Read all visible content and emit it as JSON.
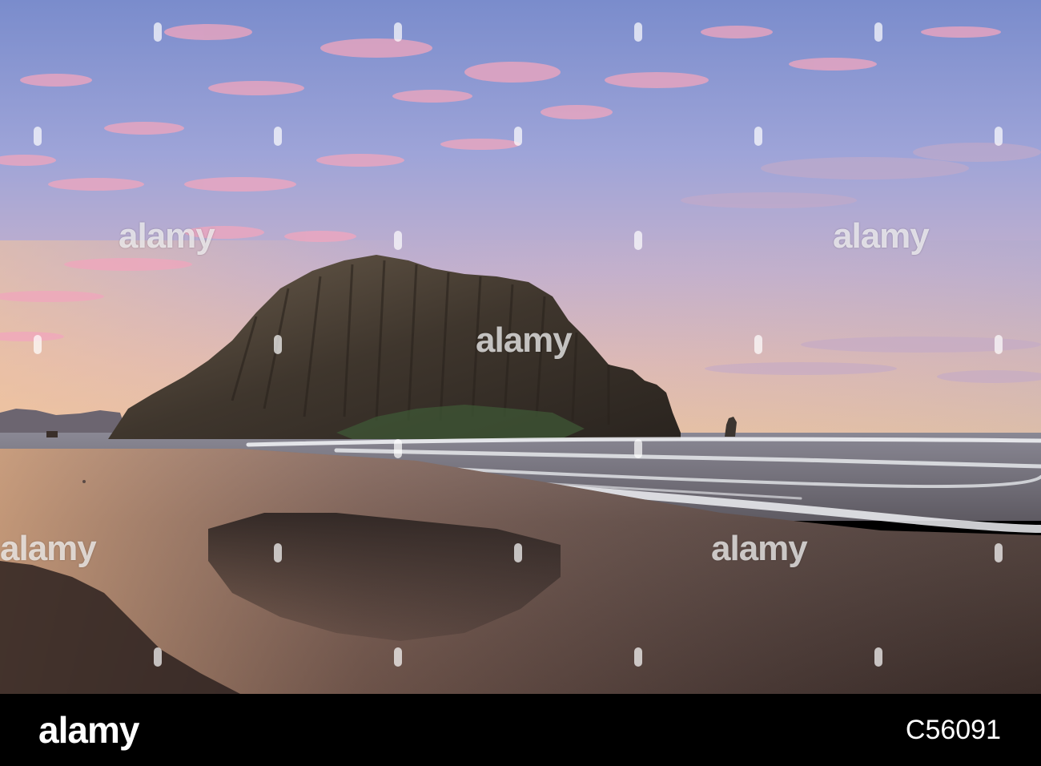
{
  "watermark": {
    "text": "alamy",
    "color": "#ffffff"
  },
  "footer": {
    "logo_text": "alamy",
    "image_id": "C56091",
    "background": "#000000",
    "text_color": "#ffffff"
  },
  "scene": {
    "subject": "rock-icon",
    "sky_colors": [
      "#7d8fd0",
      "#a9a8d8",
      "#d6b4c4",
      "#e9bd9b"
    ],
    "cloud_color": "#f2a9bf",
    "rock_color": "#3b342c",
    "sand_color": "#4a3b33",
    "wave_color": "#e8eaee"
  }
}
